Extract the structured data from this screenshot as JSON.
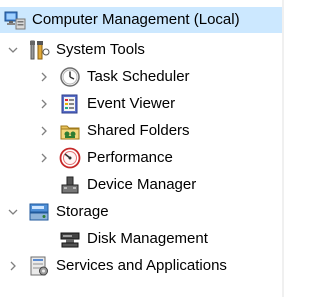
{
  "tree": {
    "root": {
      "label": "Computer Management (Local)",
      "icon": "computer-management-icon",
      "selected": true
    },
    "system_tools": {
      "label": "System Tools",
      "icon": "system-tools-icon",
      "expanded": true,
      "children": [
        {
          "label": "Task Scheduler",
          "icon": "clock-icon",
          "has_children": true
        },
        {
          "label": "Event Viewer",
          "icon": "event-viewer-icon",
          "has_children": true
        },
        {
          "label": "Shared Folders",
          "icon": "shared-folder-icon",
          "has_children": true
        },
        {
          "label": "Performance",
          "icon": "performance-gauge-icon",
          "has_children": true
        },
        {
          "label": "Device Manager",
          "icon": "device-manager-icon",
          "has_children": false
        }
      ]
    },
    "storage": {
      "label": "Storage",
      "icon": "storage-icon",
      "expanded": true,
      "children": [
        {
          "label": "Disk Management",
          "icon": "disk-management-icon",
          "has_children": false
        }
      ]
    },
    "services": {
      "label": "Services and Applications",
      "icon": "services-applications-icon",
      "expanded": false
    }
  },
  "colors": {
    "selection": "#cce8ff",
    "twisty": "#808080",
    "text": "#000000"
  }
}
